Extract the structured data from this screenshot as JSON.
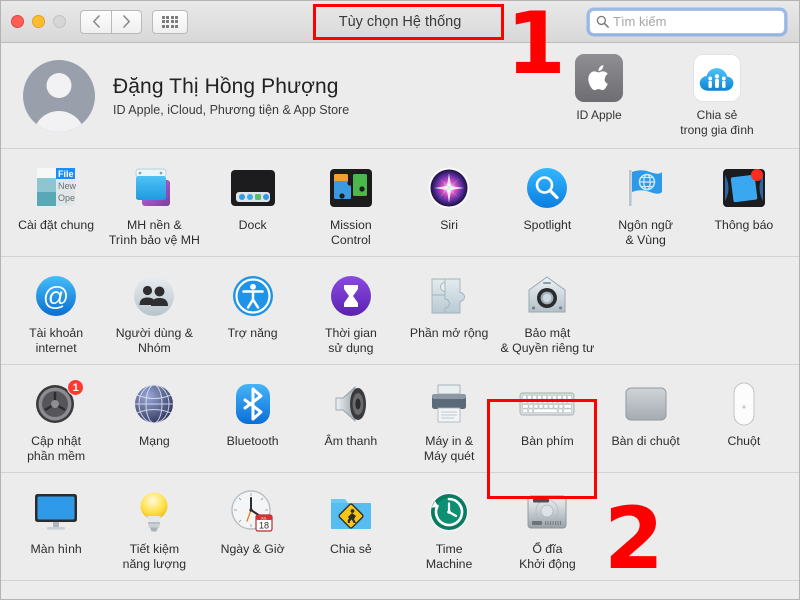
{
  "window": {
    "title": "Tùy chọn Hệ thống",
    "traffic_lights": [
      "close",
      "minimize",
      "zoom-disabled"
    ],
    "nav_back_label": "‹",
    "nav_forward_label": "›",
    "grid_button_name": "show-all"
  },
  "search": {
    "placeholder": "Tìm kiếm",
    "value": "",
    "icon": "search-icon"
  },
  "account": {
    "name": "Đặng Thị Hồng Phượng",
    "subtitle": "ID Apple, iCloud, Phương tiện & App Store",
    "avatar_icon": "user-avatar-icon",
    "items": [
      {
        "label": "ID Apple",
        "icon": "apple-logo-icon"
      },
      {
        "label": "Chia sẻ\ntrong gia đình",
        "label_line1": "Chia sẻ",
        "label_line2": "trong gia đình",
        "icon": "family-sharing-icon"
      }
    ]
  },
  "prefs": {
    "rows": [
      {
        "items": [
          {
            "label_line1": "Cài đặt chung",
            "label_line2": "",
            "icon": "general-icon",
            "badge": null
          },
          {
            "label_line1": "MH nền &",
            "label_line2": "Trình bảo vệ MH",
            "icon": "desktop-screensaver-icon",
            "badge": null
          },
          {
            "label_line1": "Dock",
            "label_line2": "",
            "icon": "dock-icon",
            "badge": null
          },
          {
            "label_line1": "Mission",
            "label_line2": "Control",
            "icon": "mission-control-icon",
            "badge": null
          },
          {
            "label_line1": "Siri",
            "label_line2": "",
            "icon": "siri-icon",
            "badge": null
          },
          {
            "label_line1": "Spotlight",
            "label_line2": "",
            "icon": "spotlight-icon",
            "badge": null
          },
          {
            "label_line1": "Ngôn ngữ",
            "label_line2": "& Vùng",
            "icon": "language-region-icon",
            "badge": null
          },
          {
            "label_line1": "Thông báo",
            "label_line2": "",
            "icon": "notifications-icon",
            "badge": null
          }
        ]
      },
      {
        "items": [
          {
            "label_line1": "Tài khoản",
            "label_line2": "internet",
            "icon": "internet-accounts-icon",
            "badge": null
          },
          {
            "label_line1": "Người dùng &",
            "label_line2": "Nhóm",
            "icon": "users-groups-icon",
            "badge": null
          },
          {
            "label_line1": "Trợ năng",
            "label_line2": "",
            "icon": "accessibility-icon",
            "badge": null
          },
          {
            "label_line1": "Thời gian",
            "label_line2": "sử dụng",
            "icon": "screen-time-icon",
            "badge": null
          },
          {
            "label_line1": "Phần mở rộng",
            "label_line2": "",
            "icon": "extensions-icon",
            "badge": null
          },
          {
            "label_line1": "Bảo mật",
            "label_line2": "& Quyền riêng tư",
            "icon": "security-privacy-icon",
            "badge": null
          },
          {
            "label_line1": "",
            "label_line2": "",
            "icon": "",
            "badge": null
          },
          {
            "label_line1": "",
            "label_line2": "",
            "icon": "",
            "badge": null
          }
        ]
      },
      {
        "items": [
          {
            "label_line1": "Cập nhật",
            "label_line2": "phần mềm",
            "icon": "software-update-icon",
            "badge": "1"
          },
          {
            "label_line1": "Mạng",
            "label_line2": "",
            "icon": "network-icon",
            "badge": null
          },
          {
            "label_line1": "Bluetooth",
            "label_line2": "",
            "icon": "bluetooth-icon",
            "badge": null
          },
          {
            "label_line1": "Âm thanh",
            "label_line2": "",
            "icon": "sound-icon",
            "badge": null
          },
          {
            "label_line1": "Máy in &",
            "label_line2": "Máy quét",
            "icon": "printers-scanners-icon",
            "badge": null
          },
          {
            "label_line1": "Bàn phím",
            "label_line2": "",
            "icon": "keyboard-icon",
            "badge": null
          },
          {
            "label_line1": "Bàn di chuột",
            "label_line2": "",
            "icon": "trackpad-icon",
            "badge": null
          },
          {
            "label_line1": "Chuột",
            "label_line2": "",
            "icon": "mouse-icon",
            "badge": null
          }
        ]
      },
      {
        "items": [
          {
            "label_line1": "Màn hình",
            "label_line2": "",
            "icon": "displays-icon",
            "badge": null
          },
          {
            "label_line1": "Tiết kiệm",
            "label_line2": "năng lượng",
            "icon": "energy-saver-icon",
            "badge": null
          },
          {
            "label_line1": "Ngày & Giờ",
            "label_line2": "",
            "icon": "date-time-icon",
            "badge": null
          },
          {
            "label_line1": "Chia sẻ",
            "label_line2": "",
            "icon": "sharing-icon",
            "badge": null
          },
          {
            "label_line1": "Time",
            "label_line2": "Machine",
            "icon": "time-machine-icon",
            "badge": null
          },
          {
            "label_line1": "Ổ đĩa",
            "label_line2": "Khởi động",
            "icon": "startup-disk-icon",
            "badge": null
          },
          {
            "label_line1": "",
            "label_line2": "",
            "icon": "",
            "badge": null
          },
          {
            "label_line1": "",
            "label_line2": "",
            "icon": "",
            "badge": null
          }
        ]
      }
    ]
  },
  "annotations": {
    "step1_number": "1",
    "step2_number": "2",
    "highlight_color": "#ff0000",
    "box1_target": "Tùy chọn Hệ thống",
    "box2_target": "Bàn phím"
  },
  "date_icon": {
    "month": "JUL",
    "day": "18"
  },
  "colors": {
    "accent_red": "#ff0000",
    "badge_red": "#ff3b30",
    "window_bg": "#ececec",
    "toolbar_top": "#e9e9e9",
    "toolbar_bottom": "#d8d8d8",
    "search_focus": "#5c96e8"
  }
}
